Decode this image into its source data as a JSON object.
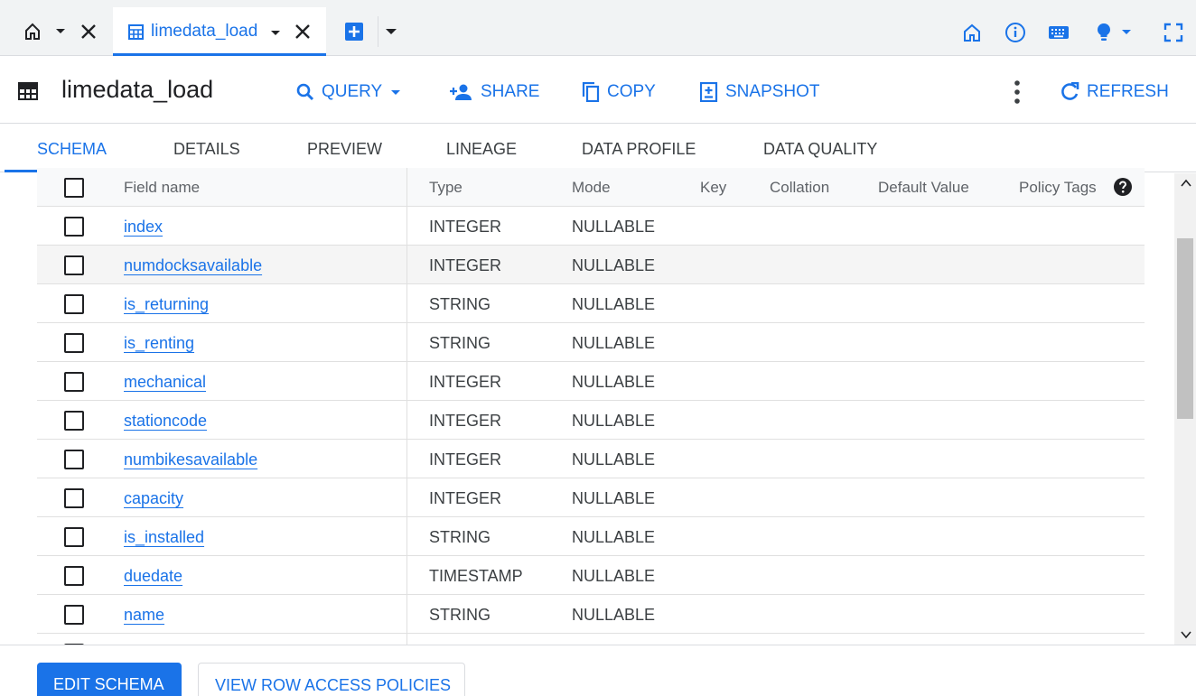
{
  "tabs": {
    "active_label": "limedata_load"
  },
  "header": {
    "title": "limedata_load",
    "actions": {
      "query": "QUERY",
      "share": "SHARE",
      "copy": "COPY",
      "snapshot": "SNAPSHOT",
      "refresh": "REFRESH"
    }
  },
  "subtabs": [
    "SCHEMA",
    "DETAILS",
    "PREVIEW",
    "LINEAGE",
    "DATA PROFILE",
    "DATA QUALITY"
  ],
  "schema": {
    "columns": [
      "Field name",
      "Type",
      "Mode",
      "Key",
      "Collation",
      "Default Value",
      "Policy Tags"
    ],
    "rows": [
      {
        "name": "index",
        "type": "INTEGER",
        "mode": "NULLABLE"
      },
      {
        "name": "numdocksavailable",
        "type": "INTEGER",
        "mode": "NULLABLE"
      },
      {
        "name": "is_returning",
        "type": "STRING",
        "mode": "NULLABLE"
      },
      {
        "name": "is_renting",
        "type": "STRING",
        "mode": "NULLABLE"
      },
      {
        "name": "mechanical",
        "type": "INTEGER",
        "mode": "NULLABLE"
      },
      {
        "name": "stationcode",
        "type": "INTEGER",
        "mode": "NULLABLE"
      },
      {
        "name": "numbikesavailable",
        "type": "INTEGER",
        "mode": "NULLABLE"
      },
      {
        "name": "capacity",
        "type": "INTEGER",
        "mode": "NULLABLE"
      },
      {
        "name": "is_installed",
        "type": "STRING",
        "mode": "NULLABLE"
      },
      {
        "name": "duedate",
        "type": "TIMESTAMP",
        "mode": "NULLABLE"
      },
      {
        "name": "name",
        "type": "STRING",
        "mode": "NULLABLE"
      }
    ]
  },
  "footer": {
    "edit_schema": "EDIT SCHEMA",
    "view_policies": "VIEW ROW ACCESS POLICIES"
  },
  "colors": {
    "accent": "#1a73e8",
    "text": "#202124",
    "muted": "#5f6368",
    "border": "#e0e0e0"
  }
}
